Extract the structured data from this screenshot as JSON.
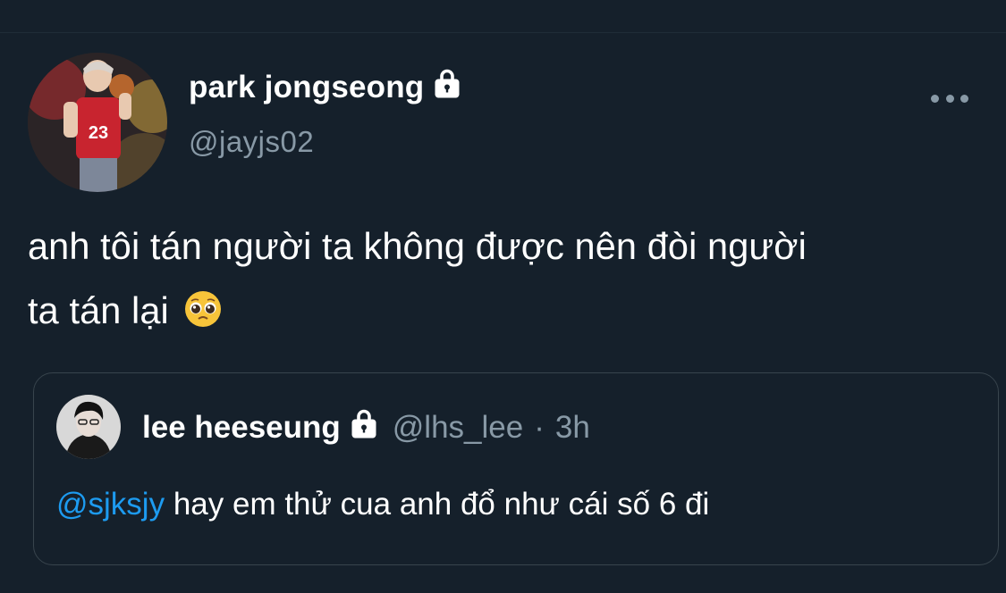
{
  "tweet": {
    "display_name": "park jongseong",
    "handle": "@jayjs02",
    "text_line1": "anh tôi tán người ta không được nên đòi người",
    "text_line2": "ta tán lại",
    "emoji": "pleading-face-emoji",
    "more_icon": "more-horizontal-icon",
    "lock_icon": "lock-icon"
  },
  "quoted_tweet": {
    "display_name": "lee heeseung",
    "handle": "@lhs_lee",
    "separator": "·",
    "time": "3h",
    "mention": "@sjksjy",
    "text": "hay em thử cua anh đổ như cái số 6 đi"
  },
  "colors": {
    "background": "#15202b",
    "text": "#ffffff",
    "secondary": "#8899a6",
    "link": "#1d9bf0",
    "border": "#38444d"
  }
}
